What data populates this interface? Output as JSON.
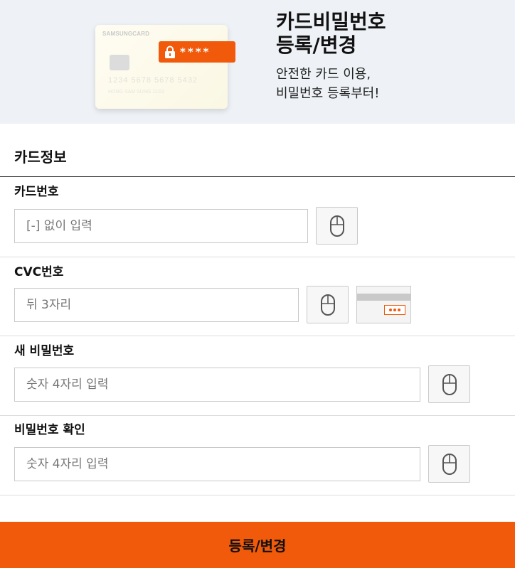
{
  "hero": {
    "title_line1": "카드비밀번호",
    "title_line2": "등록/변경",
    "subtitle_line1": "안전한 카드 이용,",
    "subtitle_line2": "비밀번호 등록부터!",
    "card_brand": "SAMSUNGCARD",
    "card_digits": "1234  5678  5678  5432",
    "card_name": "HONG SAM SUNG       11/22",
    "pin_mask": "****"
  },
  "section": {
    "title": "카드정보"
  },
  "fields": {
    "card_number": {
      "label": "카드번호",
      "placeholder": "[-] 없이 입력"
    },
    "cvc": {
      "label": "CVC번호",
      "placeholder": "뒤 3자리"
    },
    "new_password": {
      "label": "새 비밀번호",
      "placeholder": "숫자 4자리 입력"
    },
    "confirm_password": {
      "label": "비밀번호 확인",
      "placeholder": "숫자 4자리 입력"
    }
  },
  "submit": {
    "label": "등록/변경"
  },
  "colors": {
    "accent": "#f05a0a",
    "hero_bg": "#eef2f6",
    "border": "#c9c9c9"
  },
  "icons": {
    "lock": "lock-icon",
    "mouse": "mouse-icon",
    "cvc_card": "cvc-card-icon"
  }
}
